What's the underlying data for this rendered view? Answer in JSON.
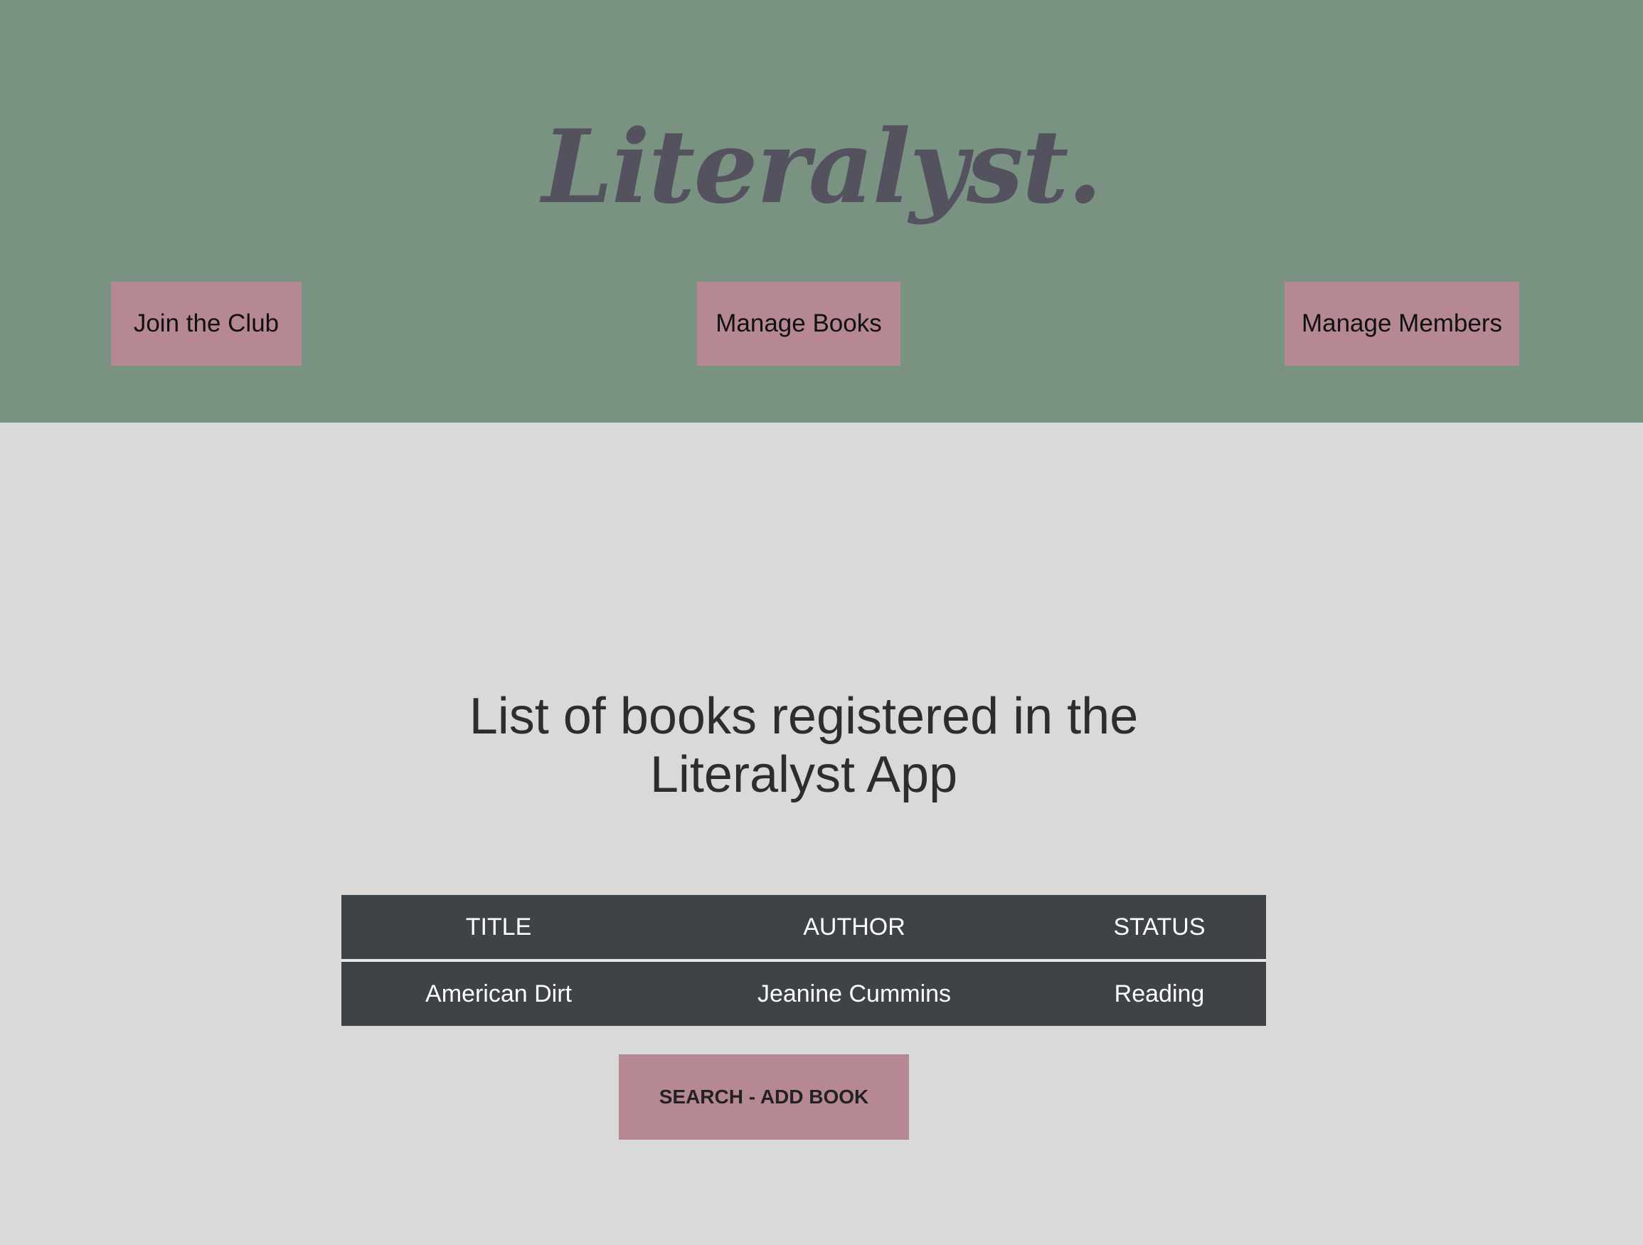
{
  "header": {
    "logo_text": "Literalyst.",
    "nav": {
      "join_label": "Join the Club",
      "books_label": "Manage Books",
      "members_label": "Manage Members"
    }
  },
  "main": {
    "heading_line1": "List of books registered in the",
    "heading_line2": "Literalyst App",
    "table": {
      "columns": [
        "TITLE",
        "AUTHOR",
        "STATUS"
      ],
      "rows": [
        [
          "American Dirt",
          "Jeanine Cummins",
          "Reading"
        ]
      ]
    },
    "search_add_label": "SEARCH - ADD BOOK"
  },
  "colors": {
    "header_bg": "#7a9282",
    "page_bg": "#d9d9d9",
    "button_bg": "#b58893",
    "table_bg": "#3e4347",
    "logo_color": "#55525f"
  }
}
